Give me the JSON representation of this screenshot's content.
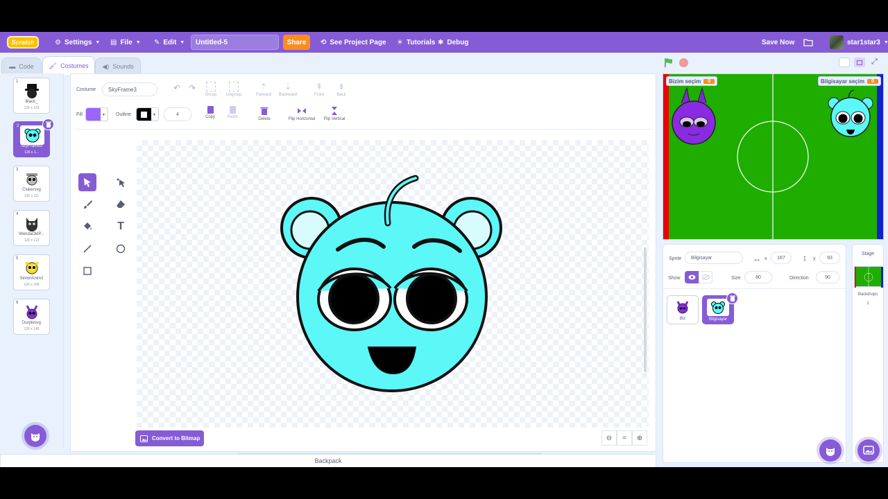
{
  "menubar": {
    "logo": "Scratch",
    "settings": "Settings",
    "file": "File",
    "edit": "Edit",
    "project_title": "Untitled-5",
    "share": "Share",
    "see_project": "See Project Page",
    "tutorials": "Tutorials",
    "debug": "Debug",
    "save_now": "Save Now",
    "username": "star1star3"
  },
  "tabs": {
    "code": "Code",
    "costumes": "Costumes",
    "sounds": "Sounds"
  },
  "costumes": [
    {
      "num": "1",
      "name": "Black_",
      "size": "126 x 133"
    },
    {
      "num": "2",
      "name": "SkyFrame3",
      "size": "126 x 1..."
    },
    {
      "num": "3",
      "name": "Clukersvg",
      "size": "126 x 111"
    },
    {
      "num": "4",
      "name": "WendaOldP...",
      "size": "126 x 113"
    },
    {
      "num": "5",
      "name": "SimonAnim2",
      "size": "126 x 106"
    },
    {
      "num": "6",
      "name": "Durplesvg",
      "size": "126 x 146"
    }
  ],
  "editor": {
    "costume_label": "Costume",
    "costume_name": "SkyFrame3",
    "group": "Group",
    "ungroup": "Ungroup",
    "forward": "Forward",
    "backward": "Backward",
    "front": "Front",
    "back": "Back",
    "fill_label": "Fill",
    "outline_label": "Outline",
    "outline_width": "4",
    "copy": "Copy",
    "paste": "Paste",
    "delete": "Delete",
    "flip_h": "Flip Horizontal",
    "flip_v": "Flip Vertical",
    "convert": "Convert to Bitmap",
    "zoom_reset": "="
  },
  "backpack": "Backpack",
  "stage": {
    "monitor_left_label": "Bizim seçim",
    "monitor_left_value": "0",
    "monitor_right_label": "Bilgisayar seçim",
    "monitor_right_value": "0"
  },
  "sprite_info": {
    "sprite_label": "Sprite",
    "sprite_name": "Bilgisayar",
    "x_label": "x",
    "x": "167",
    "y_label": "y",
    "y": "93",
    "show_label": "Show",
    "size_label": "Size",
    "size": "80",
    "direction_label": "Direction",
    "direction": "90",
    "sprites": [
      {
        "name": "Biz"
      },
      {
        "name": "Bilgisayar"
      }
    ]
  },
  "stage_panel": {
    "title": "Stage",
    "backdrops_label": "Backdrops",
    "backdrops_count": "1"
  },
  "colors": {
    "accent": "#855cd6",
    "fill": "#9966ff",
    "share": "#ff8c1a",
    "field": "#1fad00"
  }
}
